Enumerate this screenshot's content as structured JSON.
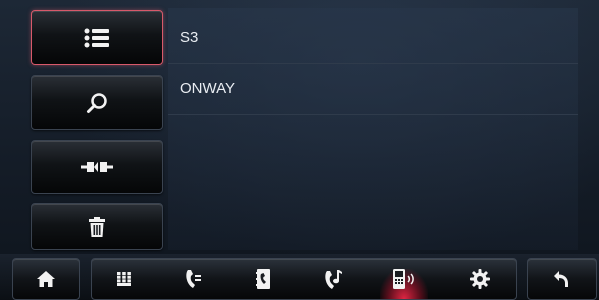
{
  "side_buttons": [
    {
      "icon": "list-icon",
      "active": true
    },
    {
      "icon": "search-icon",
      "active": false
    },
    {
      "icon": "connect-icon",
      "active": false
    },
    {
      "icon": "trash-icon",
      "active": false
    }
  ],
  "device_list": [
    {
      "name": "S3"
    },
    {
      "name": "ONWAY"
    }
  ],
  "bottom_nav": {
    "left_button": {
      "icon": "home-icon"
    },
    "items": [
      {
        "icon": "dialpad-icon",
        "active": false
      },
      {
        "icon": "call-log-icon",
        "active": false
      },
      {
        "icon": "contacts-icon",
        "active": false
      },
      {
        "icon": "music-phone-icon",
        "active": false
      },
      {
        "icon": "device-bluetooth-icon",
        "active": true
      },
      {
        "icon": "settings-icon",
        "active": false
      }
    ],
    "right_button": {
      "icon": "back-icon"
    }
  },
  "colors": {
    "active_border": "#d8596a",
    "active_glow": "#eb2846",
    "text": "#e9edf2"
  }
}
